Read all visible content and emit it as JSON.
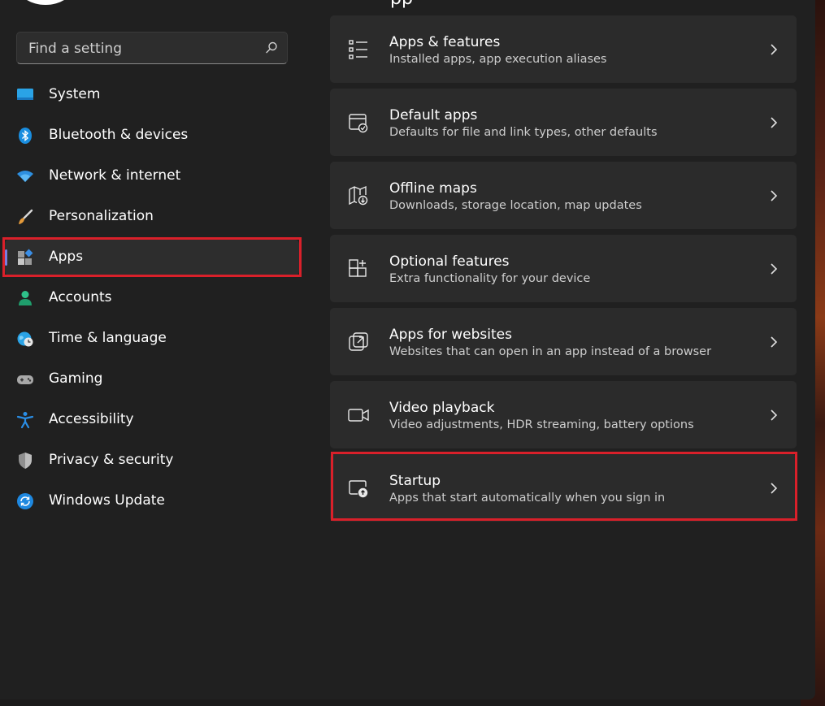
{
  "page": {
    "title_partial": "pp"
  },
  "search": {
    "placeholder": "Find a setting"
  },
  "sidebar": {
    "items": [
      {
        "label": "System",
        "icon": "system-icon"
      },
      {
        "label": "Bluetooth & devices",
        "icon": "bluetooth-icon"
      },
      {
        "label": "Network & internet",
        "icon": "wifi-icon"
      },
      {
        "label": "Personalization",
        "icon": "brush-icon"
      },
      {
        "label": "Apps",
        "icon": "apps-icon",
        "selected": true
      },
      {
        "label": "Accounts",
        "icon": "person-icon"
      },
      {
        "label": "Time & language",
        "icon": "globe-clock-icon"
      },
      {
        "label": "Gaming",
        "icon": "gamepad-icon"
      },
      {
        "label": "Accessibility",
        "icon": "accessibility-icon"
      },
      {
        "label": "Privacy & security",
        "icon": "shield-icon"
      },
      {
        "label": "Windows Update",
        "icon": "update-icon"
      }
    ]
  },
  "main": {
    "cards": [
      {
        "title": "Apps & features",
        "subtitle": "Installed apps, app execution aliases",
        "icon": "list-icon"
      },
      {
        "title": "Default apps",
        "subtitle": "Defaults for file and link types, other defaults",
        "icon": "default-apps-icon"
      },
      {
        "title": "Offline maps",
        "subtitle": "Downloads, storage location, map updates",
        "icon": "map-download-icon"
      },
      {
        "title": "Optional features",
        "subtitle": "Extra functionality for your device",
        "icon": "grid-add-icon"
      },
      {
        "title": "Apps for websites",
        "subtitle": "Websites that can open in an app instead of a browser",
        "icon": "open-external-icon"
      },
      {
        "title": "Video playback",
        "subtitle": "Video adjustments, HDR streaming, battery options",
        "icon": "video-camera-icon"
      },
      {
        "title": "Startup",
        "subtitle": "Apps that start automatically when you sign in",
        "icon": "startup-icon"
      }
    ]
  },
  "colors": {
    "background": "#202020",
    "card": "#2b2b2b",
    "accent": "#7a7fe0",
    "highlight": "#d9202a"
  }
}
